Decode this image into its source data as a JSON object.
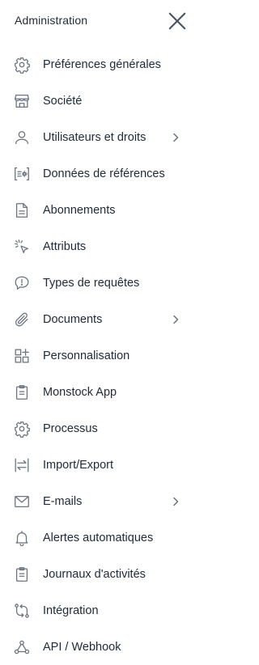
{
  "header": {
    "title": "Administration",
    "close_icon": "close-icon"
  },
  "menu": {
    "items": [
      {
        "label": "Préférences générales",
        "icon": "gear-icon",
        "has_submenu": false
      },
      {
        "label": "Société",
        "icon": "store-icon",
        "has_submenu": false
      },
      {
        "label": "Utilisateurs et droits",
        "icon": "user-icon",
        "has_submenu": true
      },
      {
        "label": "Données de références",
        "icon": "data-reference-icon",
        "has_submenu": false
      },
      {
        "label": "Abonnements",
        "icon": "document-icon",
        "has_submenu": false
      },
      {
        "label": "Attributs",
        "icon": "cursor-click-icon",
        "has_submenu": false
      },
      {
        "label": "Types de requêtes",
        "icon": "chat-alert-icon",
        "has_submenu": false
      },
      {
        "label": "Documents",
        "icon": "paperclip-icon",
        "has_submenu": true
      },
      {
        "label": "Personnalisation",
        "icon": "grid-add-icon",
        "has_submenu": false
      },
      {
        "label": "Monstock App",
        "icon": "clipboard-icon",
        "has_submenu": false
      },
      {
        "label": "Processus",
        "icon": "gear-icon",
        "has_submenu": false
      },
      {
        "label": "Import/Export",
        "icon": "import-export-icon",
        "has_submenu": false
      },
      {
        "label": "E-mails",
        "icon": "mail-icon",
        "has_submenu": true
      },
      {
        "label": "Alertes automatiques",
        "icon": "bell-icon",
        "has_submenu": false
      },
      {
        "label": "Journaux d'activités",
        "icon": "clipboard-list-icon",
        "has_submenu": false
      },
      {
        "label": "Intégration",
        "icon": "integration-sync-icon",
        "has_submenu": false
      },
      {
        "label": "API / Webhook",
        "icon": "webhook-icon",
        "has_submenu": false
      }
    ]
  },
  "colors": {
    "text": "#1f2937",
    "icon": "#6b7280",
    "background": "#ffffff"
  }
}
